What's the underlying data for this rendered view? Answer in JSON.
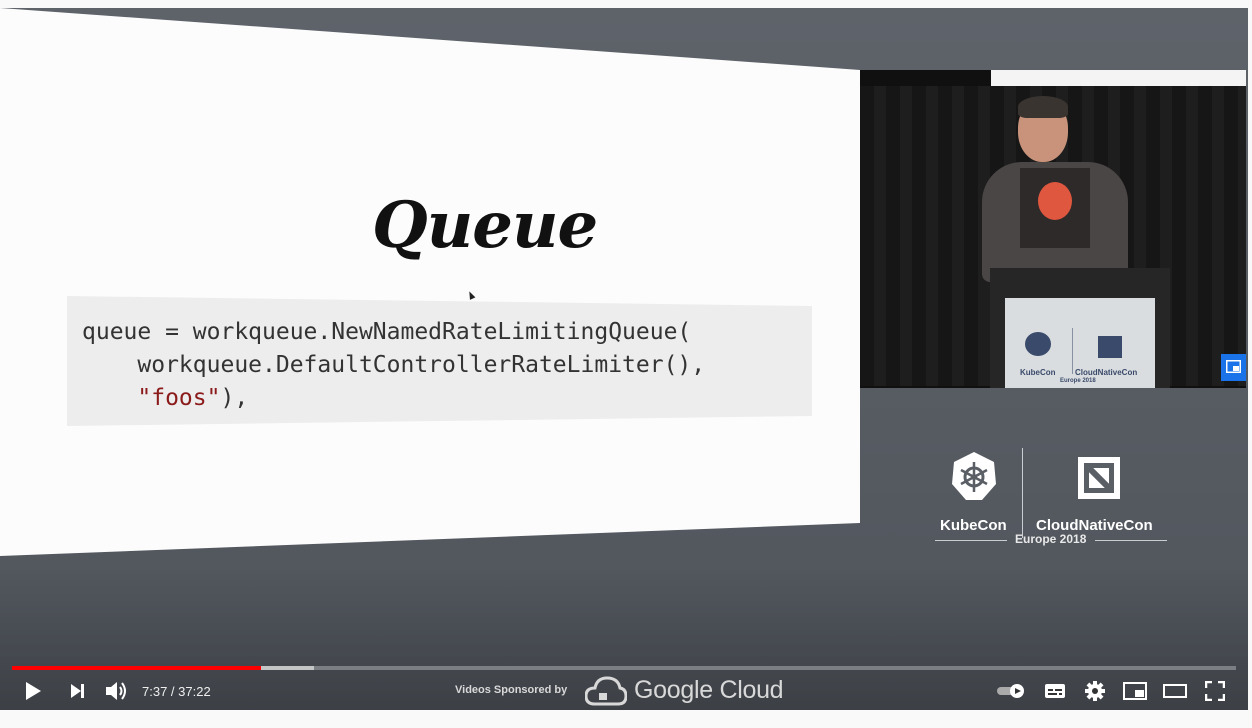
{
  "slide": {
    "title": "Queue",
    "code_lines": [
      {
        "text": "queue = workqueue.NewNamedRateLimitingQueue("
      },
      {
        "text": "    workqueue.DefaultControllerRateLimiter(),"
      },
      {
        "prefix": "    ",
        "string": "\"foos\"",
        "suffix": "),"
      }
    ]
  },
  "event_logo": {
    "kubecon": "KubeCon",
    "cloudnativecon": "CloudNativeCon",
    "edition": "Europe 2018"
  },
  "podium": {
    "kubecon": "KubeCon",
    "cloudnativecon": "CloudNativeCon",
    "edition": "Europe 2018"
  },
  "player": {
    "time_display": "7:37 / 37:22",
    "progress_played_fraction": 0.2033,
    "progress_buffered_fraction": 0.247,
    "sponsor_label": "Videos Sponsored by",
    "sponsor_brand": "Google Cloud",
    "accent_color": "#ff0000",
    "icons": [
      "play-icon",
      "next-icon",
      "volume-icon",
      "autoplay-toggle-icon",
      "subtitles-icon",
      "settings-icon",
      "miniplayer-icon",
      "theater-mode-icon",
      "fullscreen-icon",
      "picture-in-picture-icon"
    ]
  }
}
